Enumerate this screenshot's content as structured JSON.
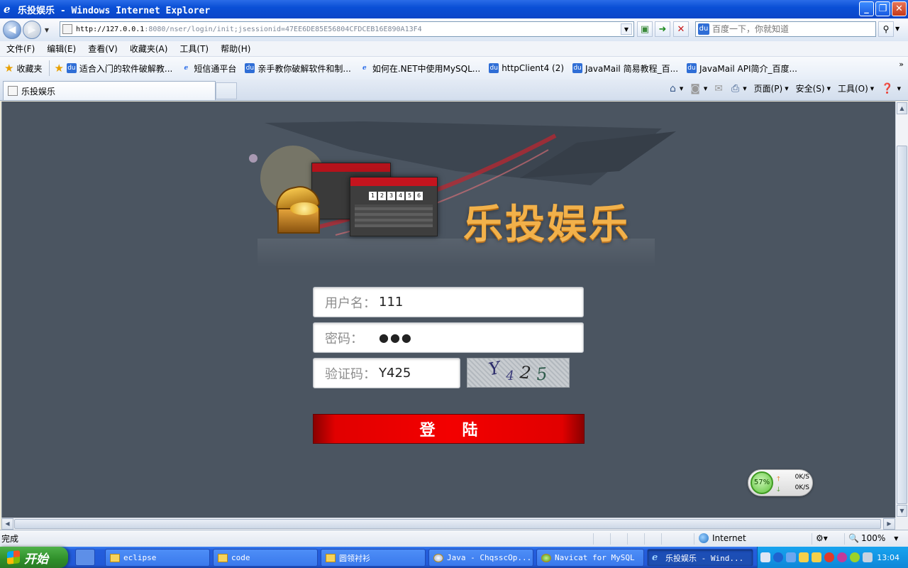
{
  "window": {
    "title": "乐投娱乐 - Windows Internet Explorer"
  },
  "addressbar": {
    "url_host": "http://127.0.0.1",
    "url_rest": ":8080/nser/login/init;jsessionid=47EE6DE85E56804CFDCEB16E890A13F4",
    "search_placeholder": "百度一下，你就知道"
  },
  "menu": {
    "items": [
      "文件(F)",
      "编辑(E)",
      "查看(V)",
      "收藏夹(A)",
      "工具(T)",
      "帮助(H)"
    ]
  },
  "favorites": {
    "label": "收藏夹",
    "items": [
      {
        "label": "适合入门的软件破解教...",
        "icon": "baidu-icon"
      },
      {
        "label": "短信通平台",
        "icon": "ie-icon"
      },
      {
        "label": "亲手教你破解软件和制...",
        "icon": "baidu-icon"
      },
      {
        "label": "如何在.NET中使用MySQL...",
        "icon": "ie-icon"
      },
      {
        "label": "httpClient4 (2)",
        "icon": "baidu-icon"
      },
      {
        "label": "JavaMail 简易教程_百...",
        "icon": "baidu-icon"
      },
      {
        "label": "JavaMail API简介_百度...",
        "icon": "baidu-icon"
      }
    ]
  },
  "tab": {
    "label": "乐投娱乐"
  },
  "commandbar": {
    "page": "页面(P)",
    "safety": "安全(S)",
    "tools": "工具(O)"
  },
  "page": {
    "banner_title": "乐投娱乐",
    "screenshot_numbers": [
      "1",
      "2",
      "3",
      "4",
      "5",
      "6"
    ],
    "username_label": "用户名：",
    "username_value": "111",
    "password_label": "密码：",
    "password_value": "●●●",
    "captcha_label": "验证码：",
    "captcha_value": "Y425",
    "captcha_chars": [
      "Y",
      "4",
      "2",
      "5"
    ],
    "login_button": "登陆"
  },
  "netwidget": {
    "percent": "57%",
    "up_speed": "0K/S",
    "down_speed": "0K/S"
  },
  "status": {
    "text": "完成",
    "zone": "Internet",
    "zoom": "100%"
  },
  "taskbar": {
    "start": "开始",
    "tasks": [
      {
        "label": "eclipse",
        "icon": "folder-icon"
      },
      {
        "label": "code",
        "icon": "folder-icon"
      },
      {
        "label": "圆领衬衫",
        "icon": "folder-icon"
      },
      {
        "label": "Java - ChqsscOp...",
        "icon": "java-icon"
      },
      {
        "label": "Navicat for MySQL",
        "icon": "navicat-icon"
      },
      {
        "label": "乐投娱乐 - Wind...",
        "icon": "ie-icon"
      }
    ],
    "clock": "13:04"
  },
  "colors": {
    "page_background": "#4B5561",
    "login_button": "#E10000",
    "banner_title": "#F2B14A"
  }
}
